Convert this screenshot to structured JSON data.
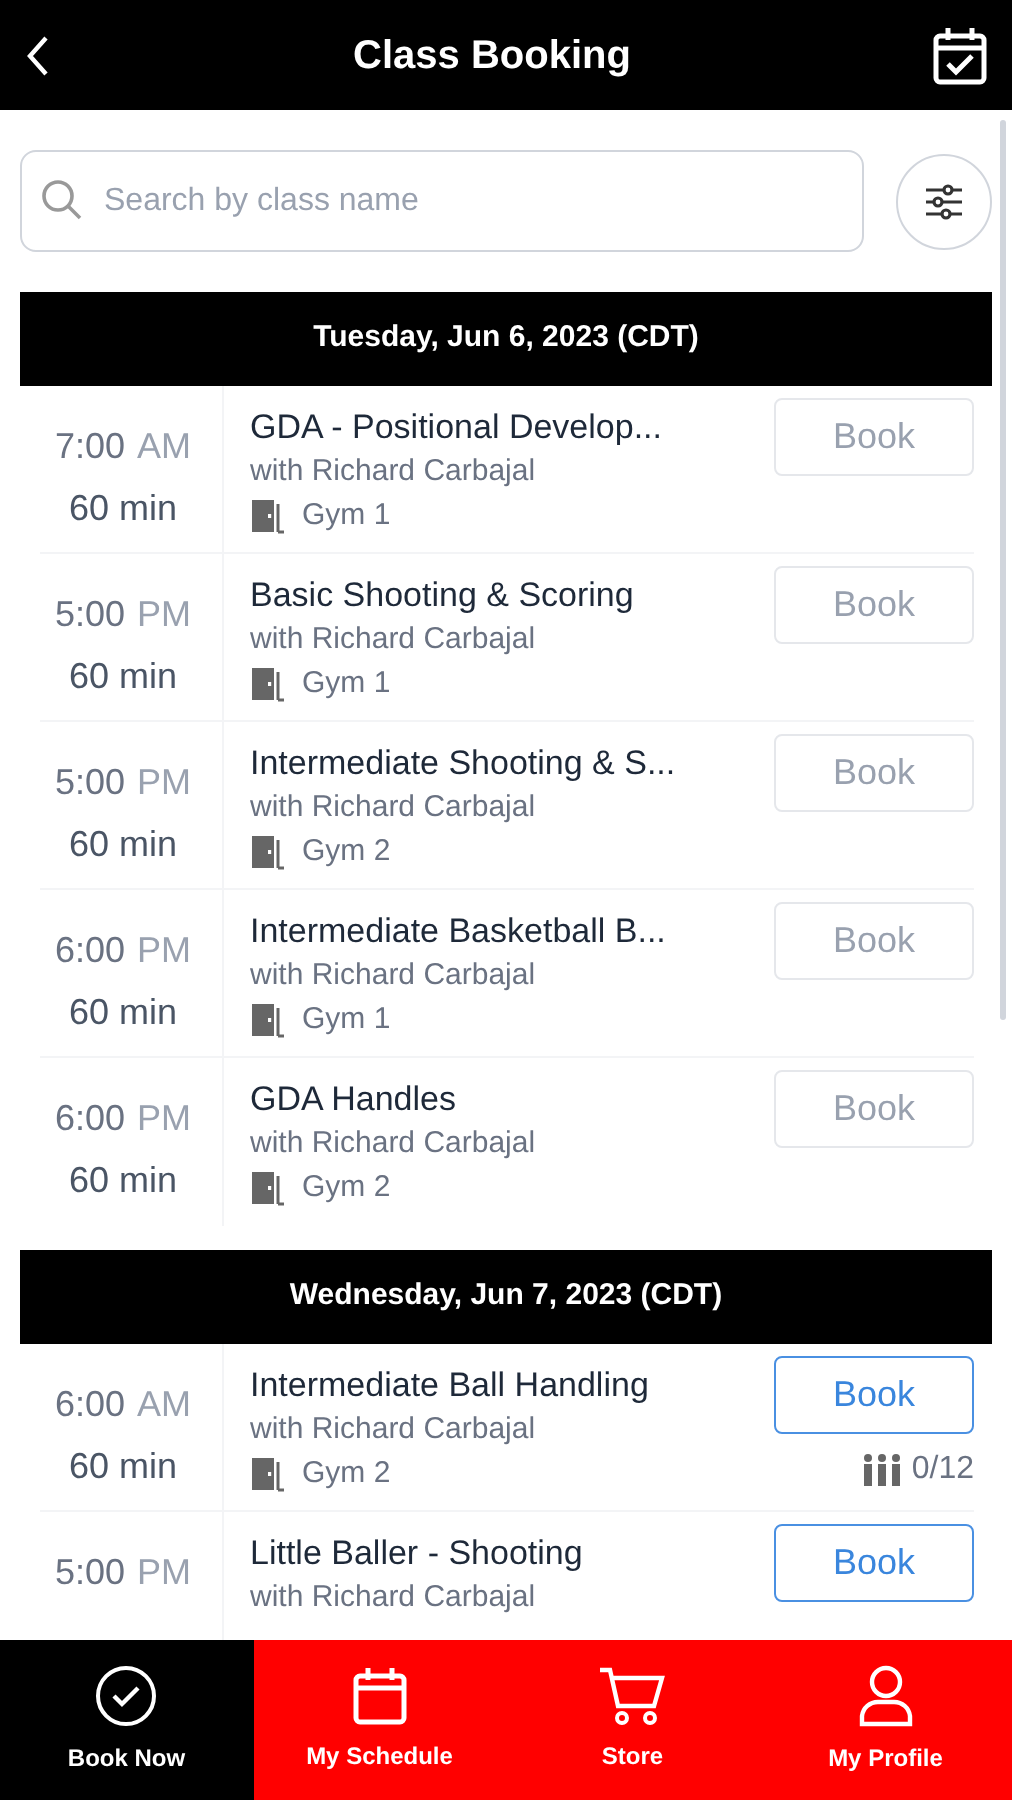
{
  "header": {
    "title": "Class Booking"
  },
  "search": {
    "placeholder": "Search by class name"
  },
  "days": [
    {
      "date": "Tuesday, Jun 6, 2023 (CDT)",
      "classes": [
        {
          "time": "7:00",
          "meridiem": "AM",
          "duration": "60 min",
          "name": "GDA - Positional Develop...",
          "instructor": "with Richard Carbajal",
          "room": "Gym 1",
          "button": "Book",
          "disabled": true
        },
        {
          "time": "5:00",
          "meridiem": "PM",
          "duration": "60 min",
          "name": "Basic Shooting & Scoring",
          "instructor": "with Richard Carbajal",
          "room": "Gym 1",
          "button": "Book",
          "disabled": true
        },
        {
          "time": "5:00",
          "meridiem": "PM",
          "duration": "60 min",
          "name": "Intermediate Shooting & S...",
          "instructor": "with Richard Carbajal",
          "room": "Gym 2",
          "button": "Book",
          "disabled": true
        },
        {
          "time": "6:00",
          "meridiem": "PM",
          "duration": "60 min",
          "name": "Intermediate Basketball B...",
          "instructor": "with Richard Carbajal",
          "room": "Gym 1",
          "button": "Book",
          "disabled": true
        },
        {
          "time": "6:00",
          "meridiem": "PM",
          "duration": "60 min",
          "name": "GDA Handles",
          "instructor": "with Richard Carbajal",
          "room": "Gym 2",
          "button": "Book",
          "disabled": true
        }
      ]
    },
    {
      "date": "Wednesday, Jun 7, 2023 (CDT)",
      "classes": [
        {
          "time": "6:00",
          "meridiem": "AM",
          "duration": "60 min",
          "name": "Intermediate Ball Handling",
          "instructor": "with Richard Carbajal",
          "room": "Gym 2",
          "button": "Book",
          "disabled": false,
          "capacity": "0/12"
        },
        {
          "time": "5:00",
          "meridiem": "PM",
          "name": "Little Baller - Shooting",
          "instructor": "with Richard Carbajal",
          "button": "Book",
          "disabled": false
        }
      ]
    }
  ],
  "tab_bar": [
    {
      "label": "Book Now",
      "kind": "check",
      "selected": true
    },
    {
      "label": "My Schedule",
      "kind": "calendar",
      "selected": false
    },
    {
      "label": "Store",
      "kind": "cart",
      "selected": false
    },
    {
      "label": "My Profile",
      "kind": "person",
      "selected": false
    }
  ]
}
